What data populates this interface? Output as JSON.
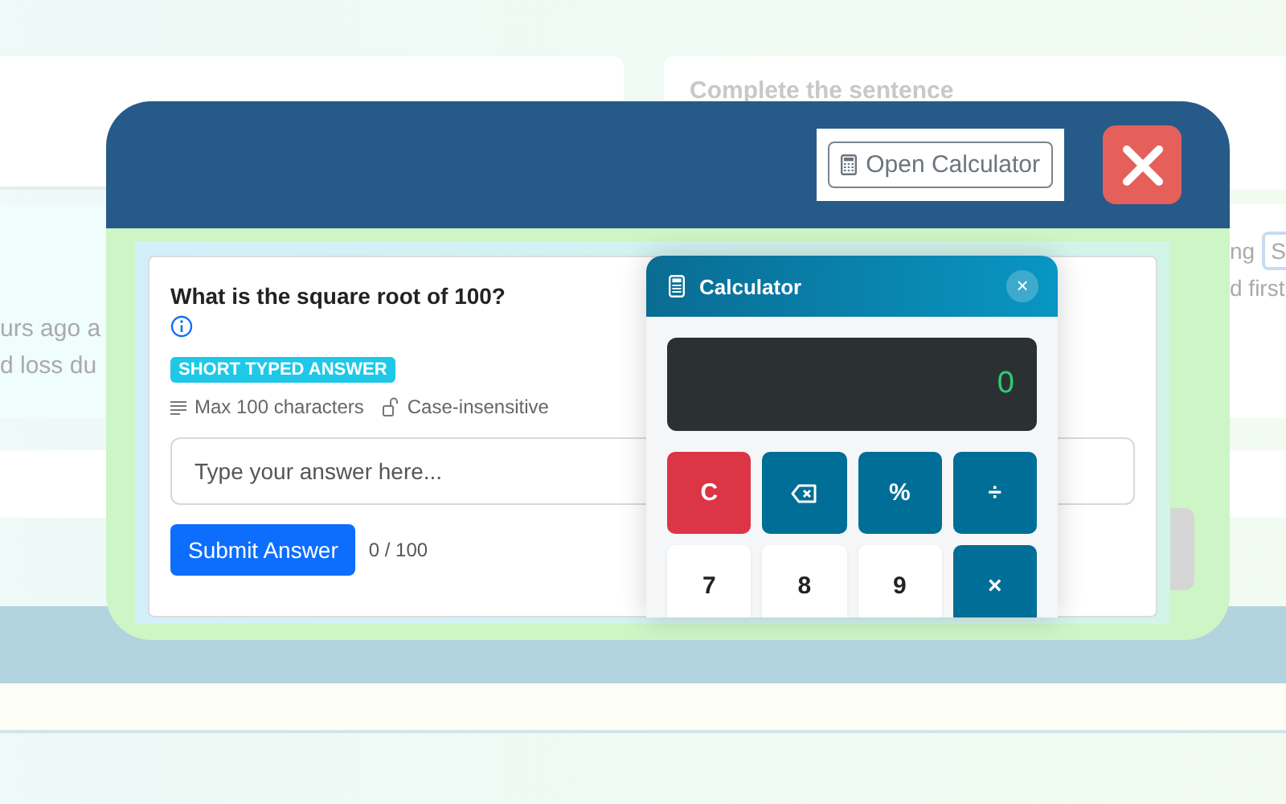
{
  "background": {
    "right_card_title": "Complete the sentence",
    "left_texts": [
      "urs ago a",
      "d loss du"
    ],
    "right_texts": [
      {
        "kind": "text",
        "text": "ng"
      },
      {
        "kind": "chip",
        "text": "S"
      },
      {
        "kind": "text",
        "text": "d first"
      }
    ]
  },
  "modal": {
    "calculator_button": "Open Calculator",
    "question": "What is the square root of 100?",
    "badge": "SHORT TYPED ANSWER",
    "hints": [
      {
        "kind": "length",
        "text": "Max 100 characters"
      },
      {
        "kind": "case",
        "text": "Case-insensitive"
      }
    ],
    "answer": {
      "placeholder": "Type your answer here..."
    },
    "submit": "Submit Answer",
    "counter": "0 / 100"
  },
  "calculator": {
    "title": "Calculator",
    "close": "×",
    "display": "0",
    "keys": [
      {
        "kind": "clear",
        "label": "C"
      },
      {
        "kind": "backspace"
      },
      {
        "kind": "operator",
        "label": "%"
      },
      {
        "kind": "operator",
        "label": "÷"
      },
      {
        "kind": "digit",
        "label": "7"
      },
      {
        "kind": "digit",
        "label": "8"
      },
      {
        "kind": "digit",
        "label": "9"
      },
      {
        "kind": "operator",
        "label": "×"
      }
    ]
  }
}
